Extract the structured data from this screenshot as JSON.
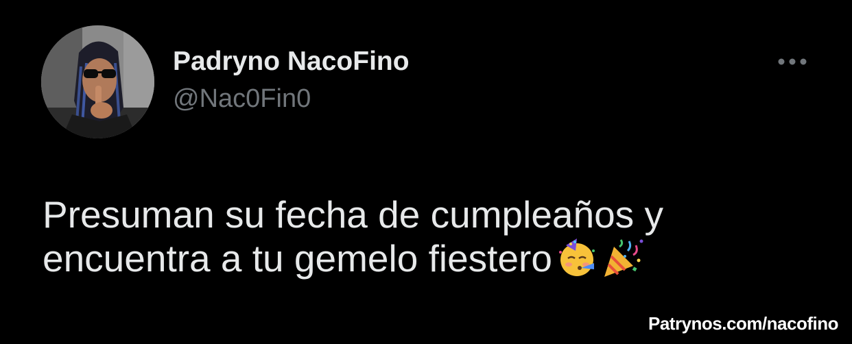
{
  "tweet": {
    "author": {
      "display_name": "Padryno NacoFino",
      "handle": "@Nac0Fin0",
      "avatar_icon": "profile-avatar"
    },
    "more_icon": "more-horizontal-icon",
    "text_lines": [
      "Presuman su fecha de cumpleaños y",
      "encuentra a tu gemelo fiestero"
    ],
    "emojis": [
      "partying-face-emoji",
      "party-popper-emoji"
    ]
  },
  "watermark": "Patrynos.com/nacofino",
  "colors": {
    "background": "#000000",
    "primary_text": "#e7e9ea",
    "secondary_text": "#71767b"
  }
}
